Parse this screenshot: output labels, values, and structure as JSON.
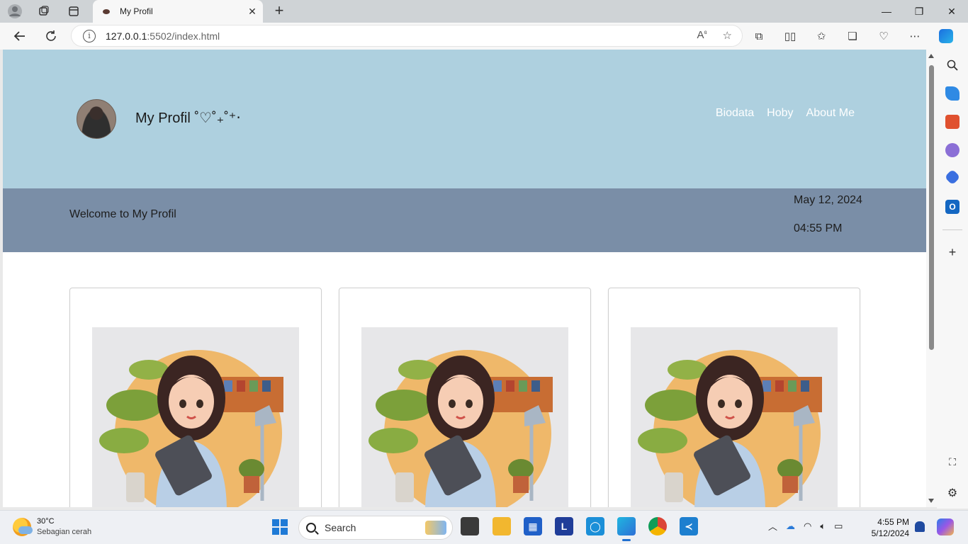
{
  "browser": {
    "tab_title": "My Profil",
    "tab_close": "✕",
    "new_tab": "+",
    "url_host": "127.0.0.1",
    "url_rest": ":5502/index.html",
    "window_controls": [
      "—",
      "❐",
      "✕"
    ]
  },
  "site": {
    "title": "My Profil ˚♡˚₊˚⁺‧",
    "nav": [
      "Biodata",
      "Hoby",
      "About Me"
    ],
    "welcome": "Welcome to My Profil",
    "date": "May 12, 2024",
    "time": "04:55 PM",
    "colors": {
      "header_bg": "#aed0df",
      "welcome_bg": "#7a8ea7",
      "nav_text": "#ffffff"
    },
    "cards": [
      {
        "image": "illustration-girl-with-tablet"
      },
      {
        "image": "illustration-girl-with-tablet"
      },
      {
        "image": "illustration-girl-with-tablet"
      }
    ]
  },
  "taskbar": {
    "weather_temp": "30°C",
    "weather_desc": "Sebagian cerah",
    "search_label": "Search",
    "clock_time": "4:55 PM",
    "clock_date": "5/12/2024"
  }
}
